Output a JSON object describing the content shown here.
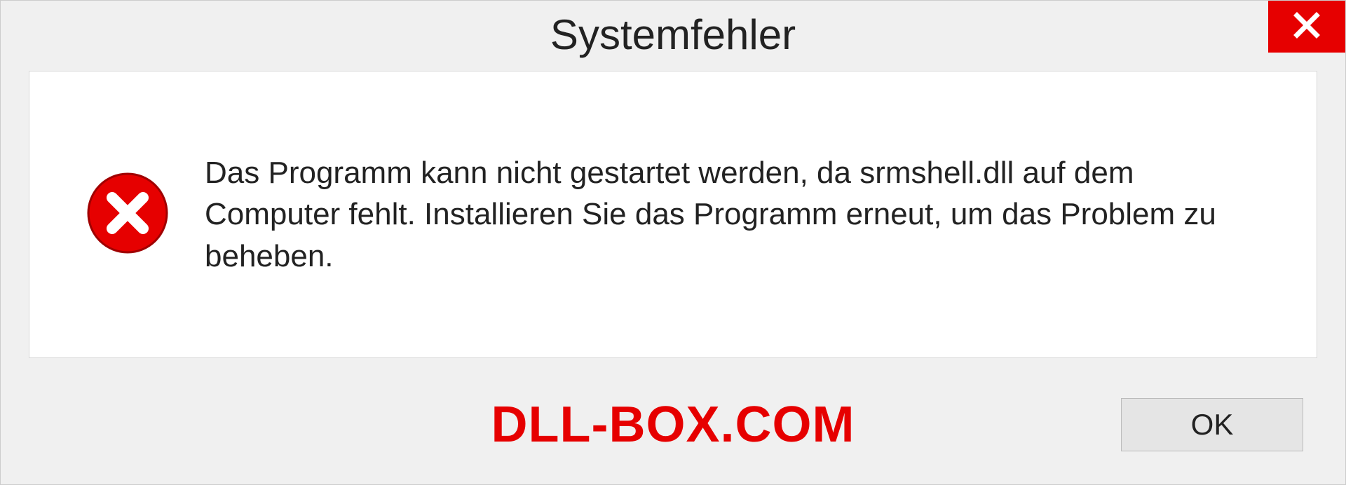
{
  "dialog": {
    "title": "Systemfehler",
    "message": "Das Programm kann nicht gestartet werden, da srmshell.dll auf dem Computer fehlt. Installieren Sie das Programm erneut, um das Problem zu beheben.",
    "ok_label": "OK"
  },
  "watermark": "DLL-BOX.COM"
}
